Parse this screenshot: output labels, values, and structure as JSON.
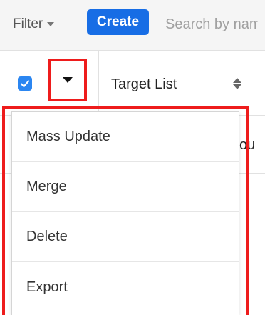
{
  "toolbar": {
    "filter_label": "Filter",
    "create_label": "Create",
    "search_placeholder": "Search by name..."
  },
  "table": {
    "column_header": "Target List",
    "partial_cell_text": "ou"
  },
  "actions_menu": {
    "items": [
      {
        "label": "Mass Update"
      },
      {
        "label": "Merge"
      },
      {
        "label": "Delete"
      },
      {
        "label": "Export"
      }
    ]
  },
  "colors": {
    "create_button": "#176de5",
    "checkbox": "#2b86f1",
    "highlight": "#ee1c1c"
  }
}
